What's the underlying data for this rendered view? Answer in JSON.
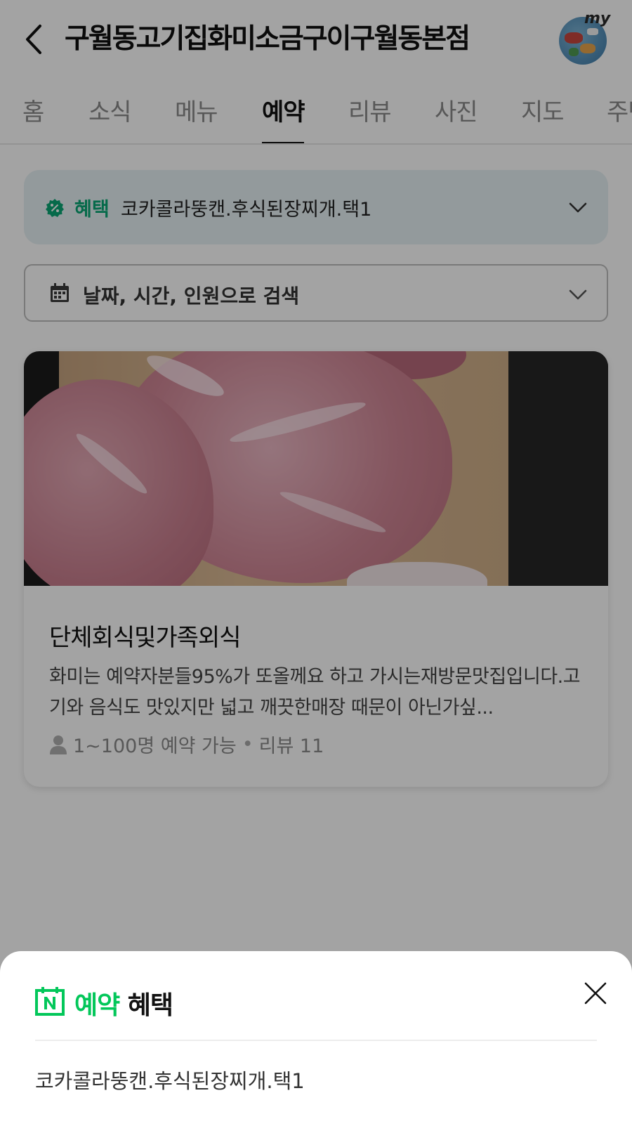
{
  "header": {
    "title": "구월동고기집화미소금구이구월동본점",
    "avatar_label": "my"
  },
  "tabs": [
    {
      "label": "홈",
      "active": false
    },
    {
      "label": "소식",
      "active": false
    },
    {
      "label": "메뉴",
      "active": false
    },
    {
      "label": "예약",
      "active": true
    },
    {
      "label": "리뷰",
      "active": false
    },
    {
      "label": "사진",
      "active": false
    },
    {
      "label": "지도",
      "active": false
    },
    {
      "label": "주변",
      "active": false
    }
  ],
  "benefit": {
    "label": "혜택",
    "text": "코카콜라뚱캔.후식된장찌개.택1"
  },
  "search": {
    "text": "날짜, 시간, 인원으로 검색"
  },
  "card": {
    "title": "단체회식및가족외식",
    "description": "화미는 예약자분들95%가 또올께요 하고 가시는재방문맛집입니다.고기와 음식도 맛있지만 넓고 깨끗한매장 때문이 아닌가싶...",
    "capacity": "1~100명 예약 가능",
    "separator": "•",
    "reviews": "리뷰 11"
  },
  "sheet": {
    "title_green": "예약",
    "title_dark": "혜택",
    "body": "코카콜라뚱캔.후식된장찌개.택1"
  },
  "colors": {
    "naver_green": "#03c75a",
    "benefit_green": "#0aa775",
    "benefit_bg": "#e7f1f4",
    "dim_overlay": "rgba(0,0,0,0.36)"
  },
  "icons": {
    "back": "back-arrow-icon",
    "benefit_badge": "percent-badge-icon",
    "calendar": "calendar-icon",
    "chevron": "chevron-down-icon",
    "person": "person-icon",
    "naver_booking": "naver-booking-icon",
    "close": "close-icon"
  }
}
